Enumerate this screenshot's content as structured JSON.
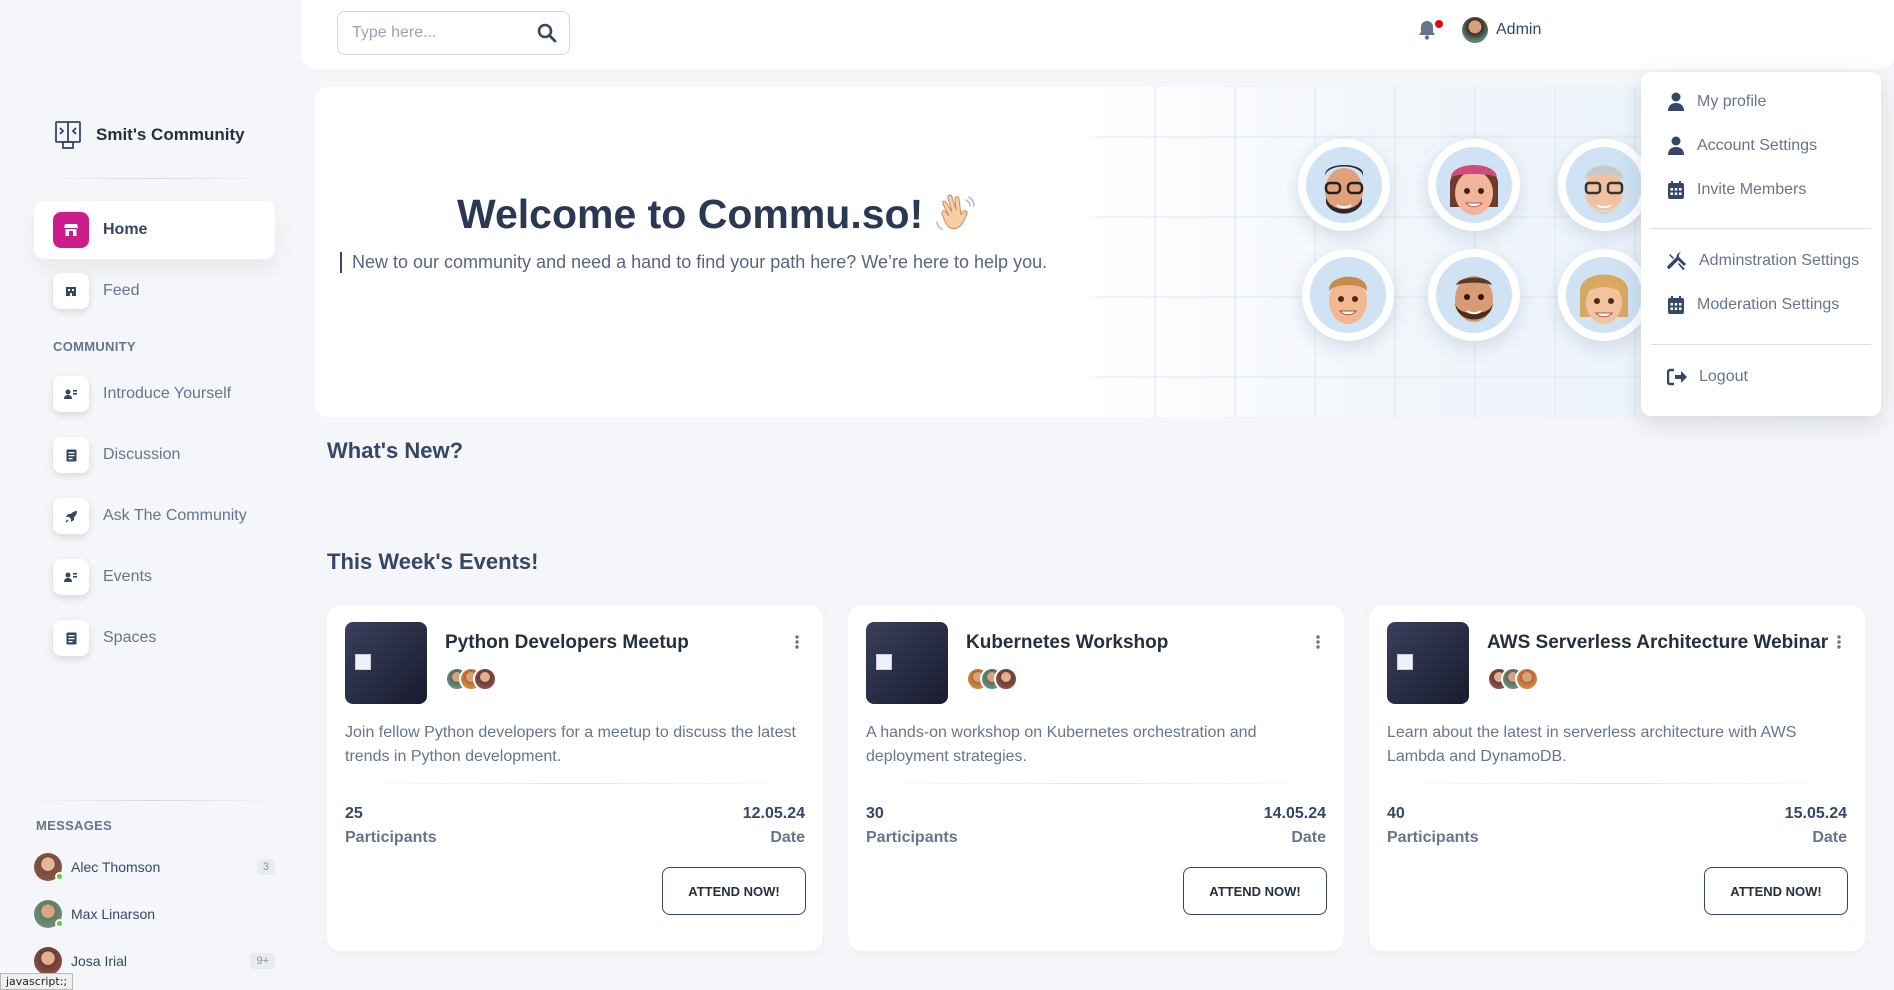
{
  "brand": {
    "name": "Smit's Community"
  },
  "sidebar": {
    "items": [
      {
        "label": "Home",
        "icon": "shop-icon",
        "active": true
      },
      {
        "label": "Feed",
        "icon": "office-icon"
      }
    ],
    "community_title": "COMMUNITY",
    "community_items": [
      {
        "label": "Introduce Yourself",
        "icon": "user-card-icon"
      },
      {
        "label": "Discussion",
        "icon": "document-icon"
      },
      {
        "label": "Ask The Community",
        "icon": "rocket-icon"
      },
      {
        "label": "Events",
        "icon": "user-card-icon"
      },
      {
        "label": "Spaces",
        "icon": "document-icon"
      }
    ],
    "messages_title": "MESSAGES",
    "messages": [
      {
        "name": "Alec Thomson",
        "count": "3"
      },
      {
        "name": "Max Linarson",
        "count": ""
      },
      {
        "name": "Josa Irial",
        "count": "9+"
      }
    ]
  },
  "topbar": {
    "search_placeholder": "Type here...",
    "user_name": "Admin"
  },
  "hero": {
    "title": "Welcome to Commu.so!",
    "subtitle": "New to our community and need a hand to find your path here? We’re here to help you."
  },
  "dropdown": {
    "items": [
      {
        "label": "My profile",
        "icon": "user-icon"
      },
      {
        "label": "Account Settings",
        "icon": "user-icon"
      },
      {
        "label": "Invite Members",
        "icon": "calendar-icon"
      },
      {
        "label": "Adminstration Settings",
        "icon": "tools-icon"
      },
      {
        "label": "Moderation Settings",
        "icon": "calendar-icon"
      },
      {
        "label": "Logout",
        "icon": "logout-icon"
      }
    ]
  },
  "sections": {
    "whats_new": "What's New?",
    "events": "This Week's Events!"
  },
  "events": [
    {
      "title": "Python Developers Meetup",
      "description": "Join fellow Python developers for a meetup to discuss the latest trends in Python development.",
      "participants": "25",
      "participants_label": "Participants",
      "date": "12.05.24",
      "date_label": "Date",
      "button": "ATTEND NOW!"
    },
    {
      "title": "Kubernetes Workshop",
      "description": "A hands-on workshop on Kubernetes orchestration and deployment strategies.",
      "participants": "30",
      "participants_label": "Participants",
      "date": "14.05.24",
      "date_label": "Date",
      "button": "ATTEND NOW!"
    },
    {
      "title": "AWS Serverless Architecture Webinar",
      "description": "Learn about the latest in serverless architecture with AWS Lambda and DynamoDB.",
      "participants": "40",
      "participants_label": "Participants",
      "date": "15.05.24",
      "date_label": "Date",
      "button": "ATTEND NOW!"
    }
  ],
  "status_bar": {
    "url": "javascript:;"
  },
  "colors": {
    "accent": "#cb1d8a",
    "text_dark": "#344767",
    "text_muted": "#67748e",
    "notification": "#ea0606"
  }
}
